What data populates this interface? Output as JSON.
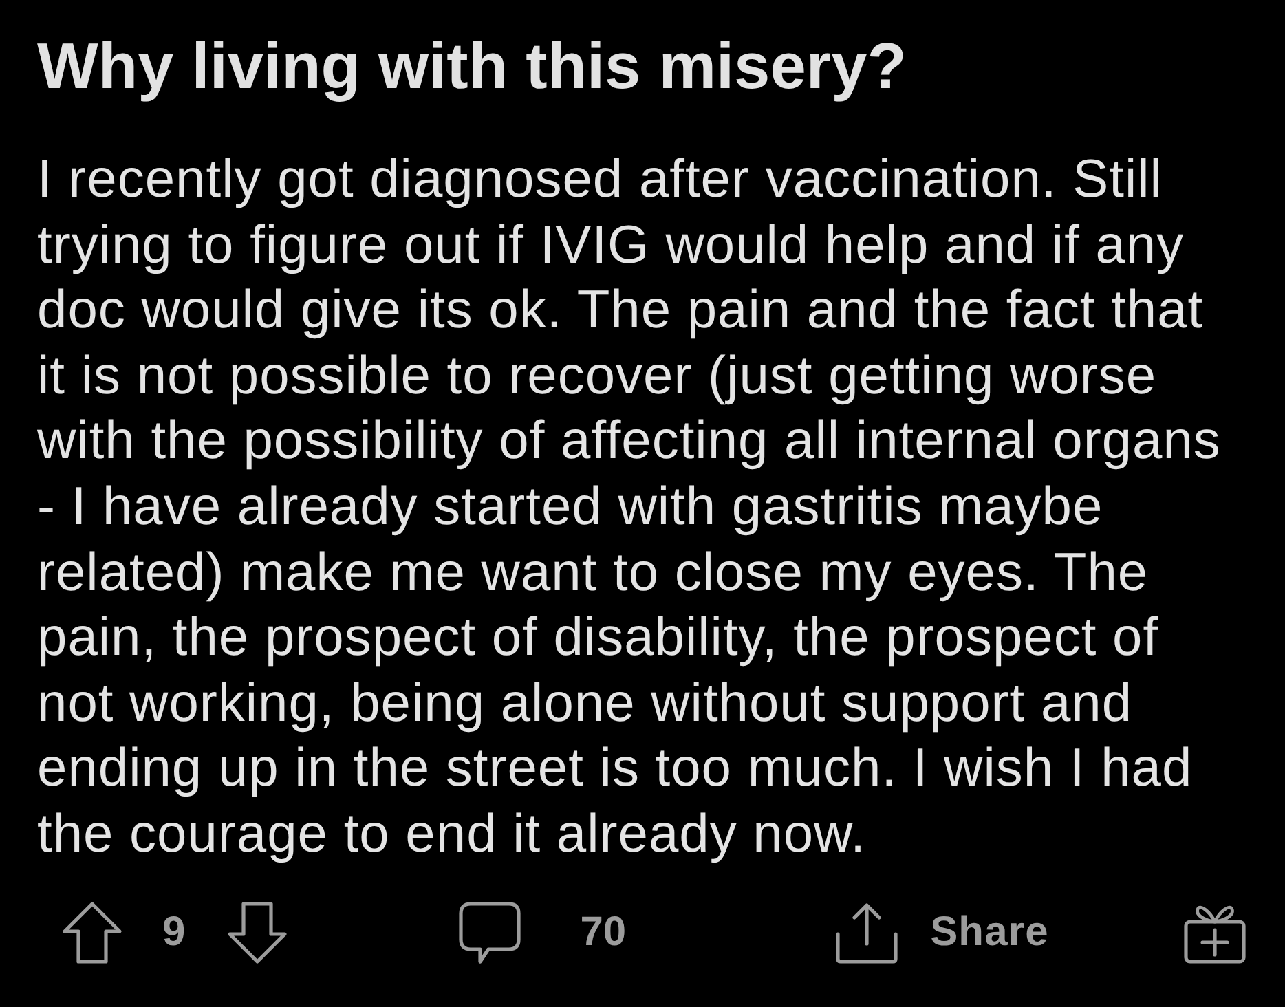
{
  "post": {
    "title": "Why living with this misery?",
    "body": "I recently got diagnosed after vaccination. Still trying to figure out if IVIG would help and if any doc would give its ok. The pain and the fact that it is not possible to recover (just getting worse with the possibility of affecting all internal organs - I have already started with gastritis maybe related) make me want to close my eyes. The pain, the prospect of disability, the prospect of not working, being alone without support and ending up in the street is too much. I wish I had the courage to end it already now."
  },
  "actions": {
    "score": "9",
    "comments": "70",
    "share": "Share"
  }
}
